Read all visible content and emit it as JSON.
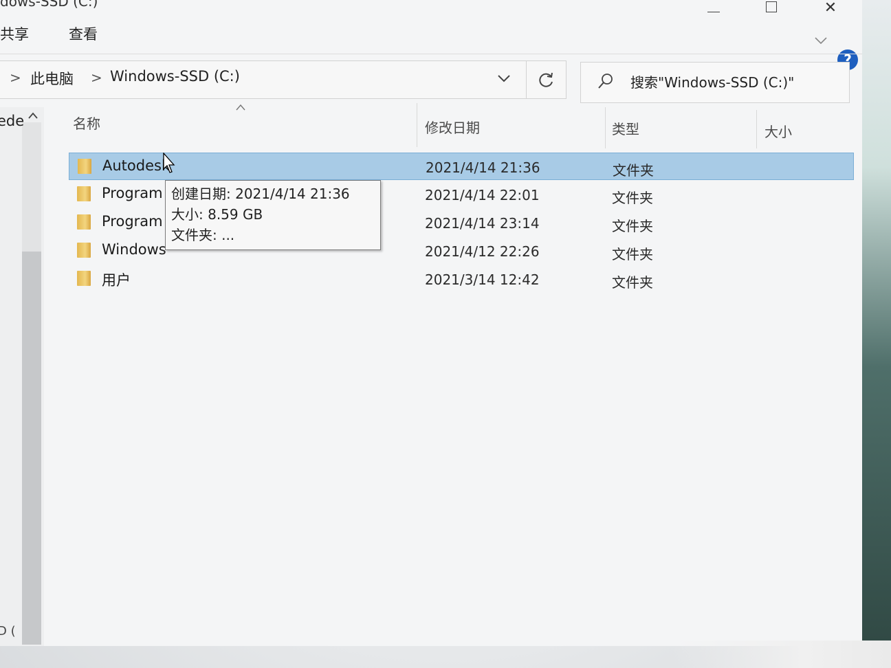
{
  "window": {
    "title": "dows-SSD (C:)",
    "controls": {
      "minimize": "—",
      "maximize": "□",
      "close": "✕"
    }
  },
  "ribbon": {
    "tabs": [
      {
        "label": "共享"
      },
      {
        "label": "查看"
      }
    ],
    "expand_icon": "chevron-down-icon",
    "help_label": "?"
  },
  "address": {
    "separators": [
      ">",
      ">"
    ],
    "breadcrumbs": [
      "此电脑",
      "Windows-SSD (C:)"
    ],
    "dropdown_icon": "chevron-down-icon",
    "refresh_icon": "refresh-icon"
  },
  "search": {
    "placeholder": "搜索\"Windows-SSD (C:)\""
  },
  "navpane": {
    "partial_label": "ede",
    "bottom_label": "D ("
  },
  "columns": {
    "name": "名称",
    "date": "修改日期",
    "type": "类型",
    "size": "大小"
  },
  "files": [
    {
      "name": "Autodesk",
      "date": "2021/4/14 21:36",
      "type": "文件夹",
      "selected": true
    },
    {
      "name": "Program",
      "date": "2021/4/14 22:01",
      "type": "文件夹",
      "selected": false
    },
    {
      "name": "Program",
      "date": "2021/4/14 23:14",
      "type": "文件夹",
      "selected": false
    },
    {
      "name": "Windows",
      "date": "2021/4/12 22:26",
      "type": "文件夹",
      "selected": false
    },
    {
      "name": "用户",
      "date": "2021/3/14 12:42",
      "type": "文件夹",
      "selected": false
    }
  ],
  "tooltip": {
    "created": "创建日期: 2021/4/14 21:36",
    "size": "大小: 8.59 GB",
    "folders": "文件夹: ..."
  },
  "colors": {
    "selection": "#a8cbe6",
    "selection_border": "#7aaed6",
    "folder": "#e3b74f",
    "help": "#1e5fbf"
  }
}
